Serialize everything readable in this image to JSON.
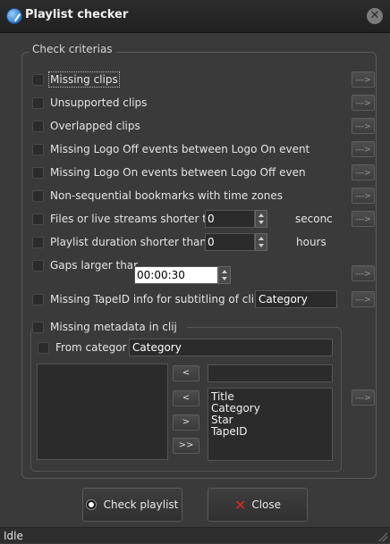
{
  "window": {
    "title": "Playlist checker",
    "app_icon": "playlist-check-icon",
    "close_icon": "close-icon",
    "close_glyph": "✕"
  },
  "group": {
    "title": "Check criterias"
  },
  "arrow_label": "--->",
  "criteria": [
    {
      "label": "Missing clips"
    },
    {
      "label": "Unsupported clips"
    },
    {
      "label": "Overlapped clips"
    },
    {
      "label": "Missing Logo Off events between Logo On event"
    },
    {
      "label": "Missing Logo On events between Logo Off even"
    },
    {
      "label": "Non-sequential bookmarks with time zones"
    },
    {
      "label": "Files or live streams shorter th",
      "value": "0",
      "suffix": "seconc"
    },
    {
      "label": "Playlist duration shorter than",
      "value": "0",
      "suffix": "hours"
    },
    {
      "label": "Gaps larger thar",
      "value": "00:00:30"
    },
    {
      "label": "Missing TapeID info for subtitling of cli",
      "value": "Category"
    }
  ],
  "metadata": {
    "label": "Missing metadata in clij",
    "from_category_label": "From categor",
    "from_category_value": "Category",
    "move_buttons": [
      "<",
      "<",
      ">",
      ">>"
    ],
    "filter_value": "",
    "available_fields": [
      "Title",
      "Category",
      "Star",
      "TapeID"
    ]
  },
  "buttons": {
    "check": "Check playlist",
    "close": "Close"
  },
  "status": {
    "text": "Idle"
  }
}
